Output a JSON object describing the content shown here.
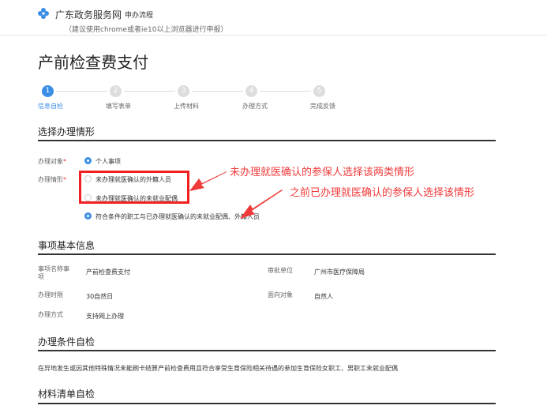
{
  "header": {
    "site_name": "广东政务服务网",
    "flow_link": "申办流程",
    "browser_tip": "（建议使用chrome或者ie10以上浏览器进行申报）"
  },
  "page_title": "产前检查费支付",
  "steps": [
    {
      "num": "1",
      "label": "信息自检"
    },
    {
      "num": "2",
      "label": "填写表单"
    },
    {
      "num": "3",
      "label": "上传材料"
    },
    {
      "num": "4",
      "label": "办理方式"
    },
    {
      "num": "5",
      "label": "完成反馈"
    }
  ],
  "situation": {
    "heading": "选择办理情形",
    "target_label": "办理对象",
    "target_option": "个人事项",
    "case_label": "办理情形",
    "required_mark": "*",
    "options": [
      "未办理就医确认的外籍人员",
      "未办理就医确认的未就业配偶",
      "符合条件的职工与已办理就医确认的未就业配偶、外籍人员"
    ]
  },
  "basic_info": {
    "heading": "事项基本信息",
    "fields": [
      {
        "label": "事项名称事项",
        "value": "产前检查费支付"
      },
      {
        "label": "审批单位",
        "value": "广州市医疗保障局"
      },
      {
        "label": "办理时限",
        "value": "30自然日"
      },
      {
        "label": "面向对象",
        "value": "自然人"
      },
      {
        "label": "办理方式",
        "value": "支持网上办理"
      }
    ]
  },
  "conditions": {
    "heading": "办理条件自检",
    "text": "在异地发生或因其他特殊情况未能刷卡结算产前检查费用且符合享受生育保险相关待遇的参加生育保险女职工、男职工未就业配偶"
  },
  "materials": {
    "heading": "材料清单自检"
  },
  "annotations": {
    "note1": "未办理就医确认的参保人选择该两类情形",
    "note2": "之前已办理就医确认的参保人选择该情形"
  },
  "colors": {
    "accent": "#3a8ee6",
    "annotation": "#f03a3a"
  }
}
